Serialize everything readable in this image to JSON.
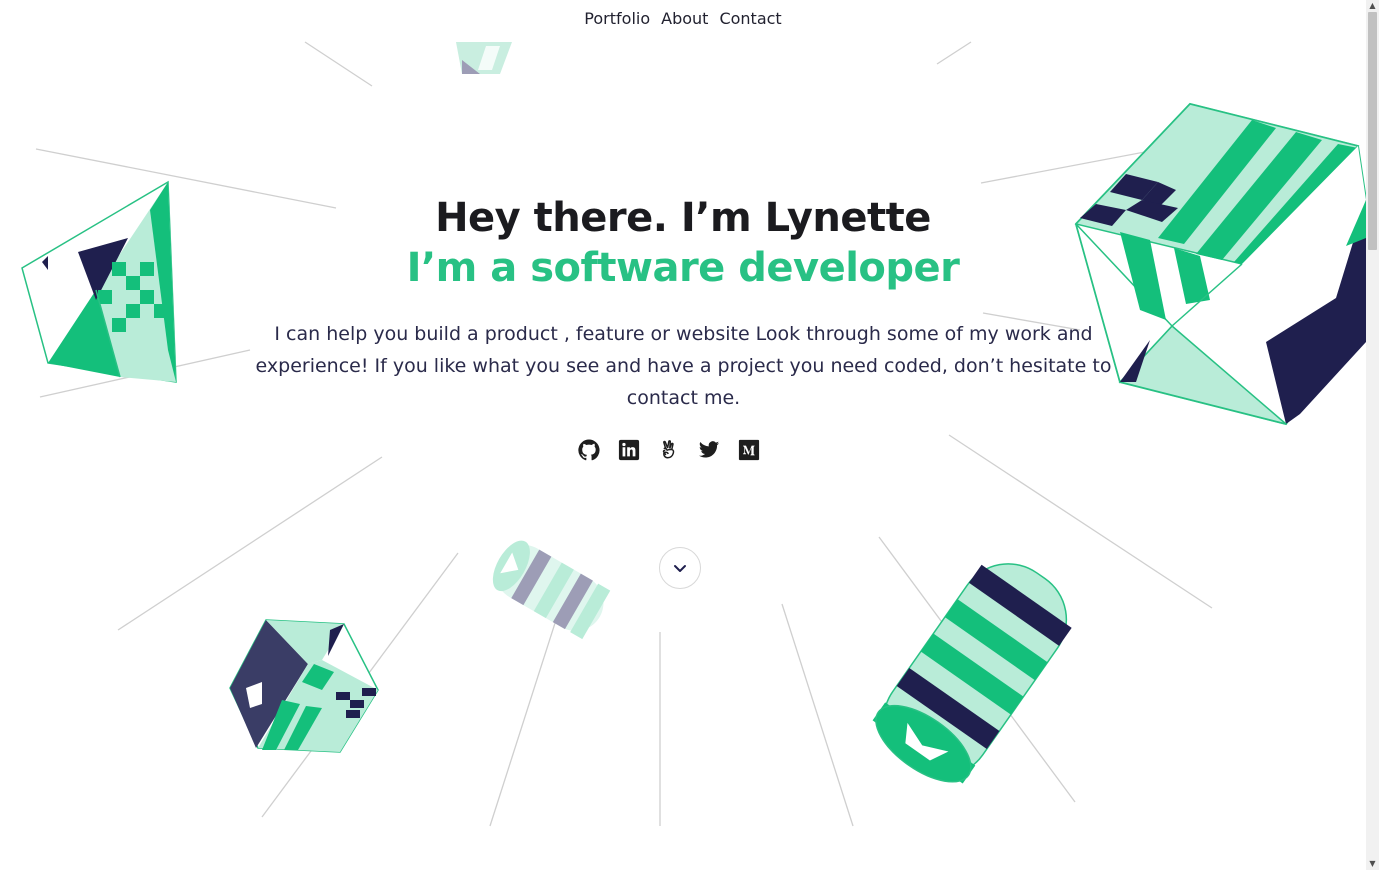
{
  "nav": {
    "items": [
      {
        "label": "Portfolio"
      },
      {
        "label": "About"
      },
      {
        "label": "Contact"
      }
    ]
  },
  "hero": {
    "title": "Hey there. I’m Lynette",
    "subtitle": "I’m a software developer",
    "intro": "I can help you build a product , feature or website Look through some of my work and experience! If you like what you see and have a project you need coded, don’t hesitate to contact me."
  },
  "socials": [
    {
      "icon": "github-icon"
    },
    {
      "icon": "linkedin-icon"
    },
    {
      "icon": "angellist-icon"
    },
    {
      "icon": "twitter-icon"
    },
    {
      "icon": "medium-icon"
    }
  ],
  "scroll_down": {
    "icon": "chevron-down-icon"
  },
  "colors": {
    "accent": "#28c184",
    "mint": "#b9ecd8",
    "navy": "#1f1f4e",
    "text": "#1b1b1f"
  }
}
